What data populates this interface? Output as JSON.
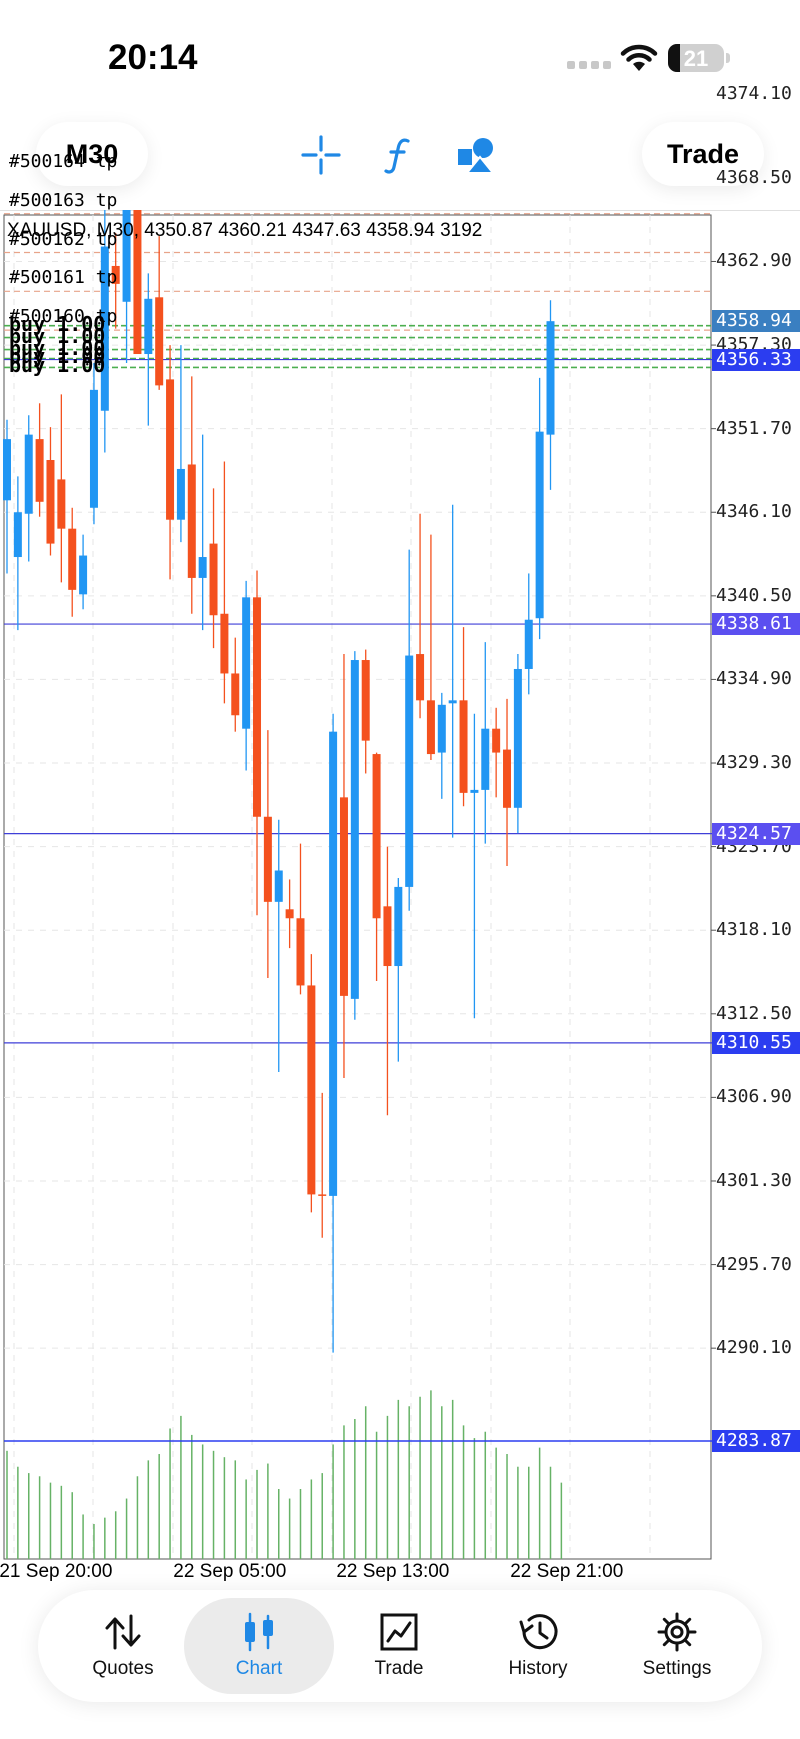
{
  "status_bar": {
    "time": "20:14",
    "battery": "21",
    "battery_level": 0.21
  },
  "toolbar": {
    "timeframe_label": "M30",
    "trade_label": "Trade",
    "icons": [
      "crosshair-icon",
      "function-icon",
      "objects-icon"
    ]
  },
  "chart": {
    "info_line": "XAUUSD, M30, 4350.87 4360.21 4347.63 4358.94 3192",
    "price_ticks": [
      "4374.10",
      "4368.50",
      "4362.90",
      "4357.30",
      "4351.70",
      "4346.10",
      "4340.50",
      "4334.90",
      "4329.30",
      "4323.70",
      "4318.10",
      "4312.50",
      "4306.90",
      "4301.30",
      "4295.70",
      "4290.10"
    ],
    "order_labels": [
      "#500164 tp",
      "#500163 tp",
      "#500162 tp",
      "#500161 tp",
      "#500160 tp"
    ],
    "buy_labels": [
      "buy 1.00",
      "buy 1.00",
      "buy 1.00",
      "buy 1.00",
      "buy 1.00"
    ],
    "time_labels": [
      "21 Sep 20:00",
      "22 Sep 05:00",
      "22 Sep 13:00",
      "22 Sep 21:00"
    ],
    "price_tags": [
      {
        "value": "4358.94",
        "color": "#3a7fc1"
      },
      {
        "value": "4356.33",
        "color": "#2b3df0"
      },
      {
        "value": "4338.61",
        "color": "#5b4ff0"
      },
      {
        "value": "4324.57",
        "color": "#5b4ff0"
      },
      {
        "value": "4310.55",
        "color": "#2b3df0"
      },
      {
        "value": "4283.87",
        "color": "#2b3df0"
      }
    ]
  },
  "chart_data": {
    "type": "candlestick",
    "symbol": "XAUUSD",
    "timeframe": "M30",
    "ylim": [
      4289.2,
      4377.0
    ],
    "candles": [
      {
        "o": 4346.9,
        "h": 4352.3,
        "l": 4342.0,
        "c": 4351.0
      },
      {
        "o": 4343.1,
        "h": 4348.5,
        "l": 4338.2,
        "c": 4346.1
      },
      {
        "o": 4346.0,
        "h": 4352.6,
        "l": 4342.8,
        "c": 4351.3
      },
      {
        "o": 4351.0,
        "h": 4353.4,
        "l": 4345.8,
        "c": 4346.8
      },
      {
        "o": 4349.6,
        "h": 4351.8,
        "l": 4343.2,
        "c": 4344.0
      },
      {
        "o": 4348.3,
        "h": 4354.0,
        "l": 4341.4,
        "c": 4345.0
      },
      {
        "o": 4345.0,
        "h": 4346.4,
        "l": 4339.1,
        "c": 4340.9
      },
      {
        "o": 4340.6,
        "h": 4344.6,
        "l": 4339.6,
        "c": 4343.2
      },
      {
        "o": 4346.4,
        "h": 4356.1,
        "l": 4345.3,
        "c": 4354.3
      },
      {
        "o": 4352.9,
        "h": 4367.5,
        "l": 4350.1,
        "c": 4363.9
      },
      {
        "o": 4362.6,
        "h": 4364.8,
        "l": 4358.4,
        "c": 4361.4
      },
      {
        "o": 4360.2,
        "h": 4371.0,
        "l": 4356.1,
        "c": 4369.1
      },
      {
        "o": 4369.2,
        "h": 4376.0,
        "l": 4359.3,
        "c": 4356.7
      },
      {
        "o": 4356.7,
        "h": 4362.1,
        "l": 4351.9,
        "c": 4360.4
      },
      {
        "o": 4360.5,
        "h": 4364.6,
        "l": 4354.3,
        "c": 4354.6
      },
      {
        "o": 4355.0,
        "h": 4357.3,
        "l": 4341.6,
        "c": 4345.6
      },
      {
        "o": 4345.6,
        "h": 4357.3,
        "l": 4344.1,
        "c": 4349.0
      },
      {
        "o": 4349.3,
        "h": 4355.2,
        "l": 4339.3,
        "c": 4341.7
      },
      {
        "o": 4341.7,
        "h": 4351.3,
        "l": 4338.2,
        "c": 4343.1
      },
      {
        "o": 4344.0,
        "h": 4347.7,
        "l": 4337.0,
        "c": 4339.2
      },
      {
        "o": 4339.3,
        "h": 4349.5,
        "l": 4333.3,
        "c": 4335.3
      },
      {
        "o": 4335.3,
        "h": 4337.7,
        "l": 4331.4,
        "c": 4332.5
      },
      {
        "o": 4331.6,
        "h": 4341.5,
        "l": 4328.8,
        "c": 4340.4
      },
      {
        "o": 4340.4,
        "h": 4342.2,
        "l": 4319.1,
        "c": 4325.7
      },
      {
        "o": 4325.7,
        "h": 4331.5,
        "l": 4314.9,
        "c": 4320.0
      },
      {
        "o": 4320.0,
        "h": 4325.5,
        "l": 4308.6,
        "c": 4322.1
      },
      {
        "o": 4319.5,
        "h": 4321.5,
        "l": 4316.9,
        "c": 4318.9
      },
      {
        "o": 4318.9,
        "h": 4323.9,
        "l": 4313.8,
        "c": 4314.4
      },
      {
        "o": 4314.4,
        "h": 4316.5,
        "l": 4299.2,
        "c": 4300.4
      },
      {
        "o": 4300.4,
        "h": 4307.2,
        "l": 4297.5,
        "c": 4300.3
      },
      {
        "o": 4300.3,
        "h": 4332.6,
        "l": 4289.8,
        "c": 4331.4
      },
      {
        "o": 4327.0,
        "h": 4336.6,
        "l": 4308.2,
        "c": 4313.7
      },
      {
        "o": 4313.5,
        "h": 4336.8,
        "l": 4312.1,
        "c": 4336.2
      },
      {
        "o": 4336.2,
        "h": 4336.9,
        "l": 4328.6,
        "c": 4330.8
      },
      {
        "o": 4329.9,
        "h": 4330.0,
        "l": 4314.7,
        "c": 4318.9
      },
      {
        "o": 4319.7,
        "h": 4323.7,
        "l": 4305.7,
        "c": 4315.7
      },
      {
        "o": 4315.7,
        "h": 4321.6,
        "l": 4309.3,
        "c": 4321.0
      },
      {
        "o": 4321.0,
        "h": 4343.6,
        "l": 4319.4,
        "c": 4336.5
      },
      {
        "o": 4336.6,
        "h": 4346.0,
        "l": 4332.3,
        "c": 4333.5
      },
      {
        "o": 4333.5,
        "h": 4344.6,
        "l": 4329.5,
        "c": 4329.9
      },
      {
        "o": 4330.0,
        "h": 4334.0,
        "l": 4326.9,
        "c": 4333.2
      },
      {
        "o": 4333.3,
        "h": 4346.6,
        "l": 4324.3,
        "c": 4333.5
      },
      {
        "o": 4333.5,
        "h": 4338.4,
        "l": 4326.4,
        "c": 4327.3
      },
      {
        "o": 4327.3,
        "h": 4332.6,
        "l": 4312.2,
        "c": 4327.5
      },
      {
        "o": 4327.5,
        "h": 4337.4,
        "l": 4323.9,
        "c": 4331.6
      },
      {
        "o": 4331.6,
        "h": 4333.0,
        "l": 4327.0,
        "c": 4330.0
      },
      {
        "o": 4330.2,
        "h": 4333.6,
        "l": 4322.4,
        "c": 4326.3
      },
      {
        "o": 4326.3,
        "h": 4336.6,
        "l": 4324.6,
        "c": 4335.6
      },
      {
        "o": 4335.6,
        "h": 4342.0,
        "l": 4333.9,
        "c": 4338.9
      },
      {
        "o": 4339.0,
        "h": 4355.1,
        "l": 4337.6,
        "c": 4351.5
      },
      {
        "o": 4351.3,
        "h": 4360.3,
        "l": 4347.6,
        "c": 4358.9
      }
    ],
    "volumes": [
      34,
      29,
      27,
      26,
      24,
      23,
      21,
      14,
      11,
      13,
      15,
      19,
      26,
      31,
      33,
      41,
      45,
      39,
      36,
      34,
      32,
      31,
      25,
      28,
      30,
      22,
      19,
      22,
      25,
      27,
      36,
      42,
      44,
      48,
      40,
      45,
      50,
      48,
      51,
      53,
      48,
      50,
      42,
      38,
      40,
      35,
      33,
      29,
      29,
      35,
      29,
      24
    ],
    "volume_max": 55,
    "x_ticks": [
      {
        "index": 5,
        "label": "21 Sep 20:00"
      },
      {
        "index": 21,
        "label": "22 Sep 05:00"
      },
      {
        "index": 36,
        "label": "22 Sep 13:00"
      },
      {
        "index": 52,
        "label": "22 Sep 21:00"
      }
    ],
    "tp_levels": [
      4368.7,
      4366.1,
      4363.5,
      4360.9,
      4358.3
    ],
    "buy_levels": [
      4358.6,
      4357.8,
      4357.0,
      4356.4,
      4355.8
    ],
    "levels": [
      4356.33,
      4338.61,
      4324.57,
      4310.55
    ],
    "volume_level_line": true,
    "up_color": "#2196f3",
    "down_color": "#f4511e",
    "volume_color": "#66b266",
    "grid": true
  },
  "tabs": [
    {
      "label": "Quotes",
      "icon": "quotes-icon",
      "active": false
    },
    {
      "label": "Chart",
      "icon": "chart-icon",
      "active": true
    },
    {
      "label": "Trade",
      "icon": "trade-icon",
      "active": false
    },
    {
      "label": "History",
      "icon": "history-icon",
      "active": false
    },
    {
      "label": "Settings",
      "icon": "settings-icon",
      "active": false
    }
  ]
}
